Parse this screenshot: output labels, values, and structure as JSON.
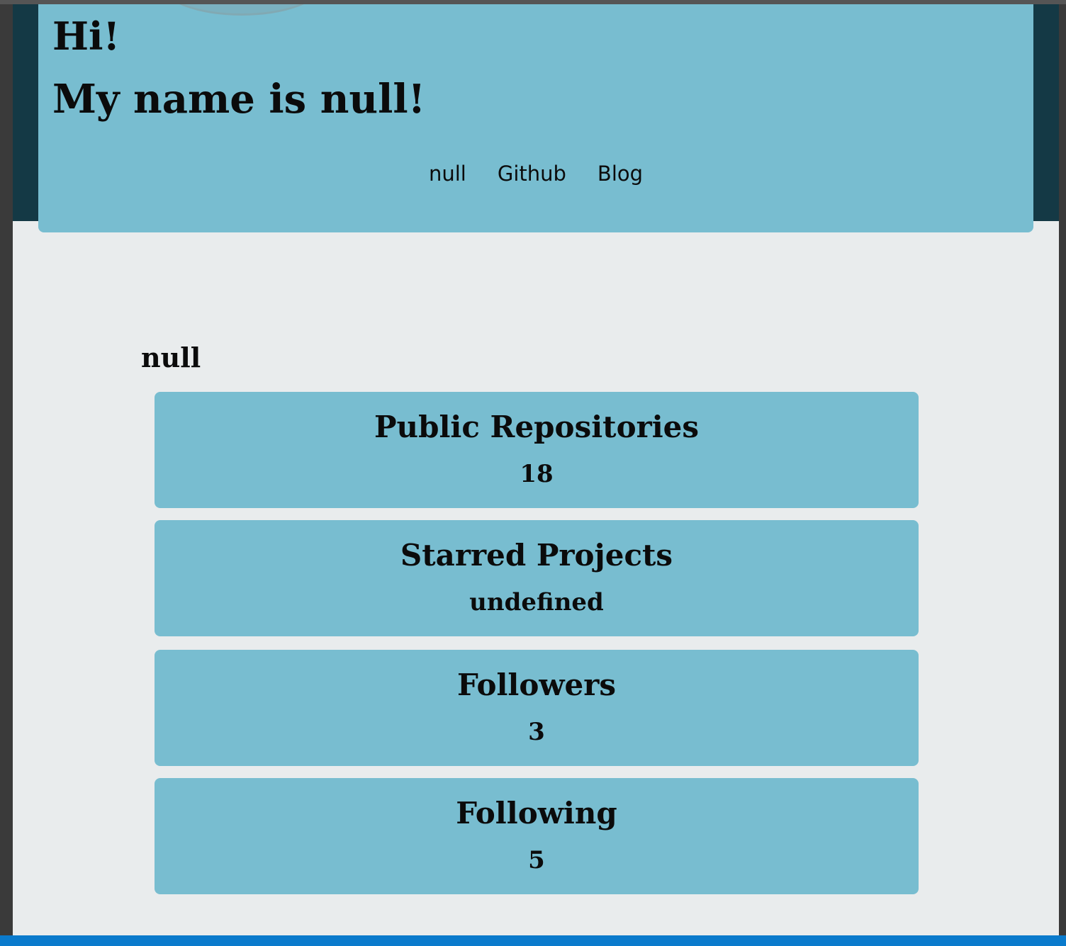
{
  "header": {
    "greeting": "Hi!",
    "name_line": "My name is null!",
    "nav": {
      "name_link": "null",
      "github_link": "Github",
      "blog_link": "Blog"
    }
  },
  "main": {
    "username": "null",
    "stats": [
      {
        "title": "Public Repositories",
        "value": "18"
      },
      {
        "title": "Starred Projects",
        "value": "undefined"
      },
      {
        "title": "Followers",
        "value": "3"
      },
      {
        "title": "Following",
        "value": "5"
      }
    ]
  },
  "colors": {
    "header_bg": "#78bdd0",
    "band_bg": "#143945",
    "page_bg": "#e9eced",
    "status_bar": "#0a7acc"
  }
}
